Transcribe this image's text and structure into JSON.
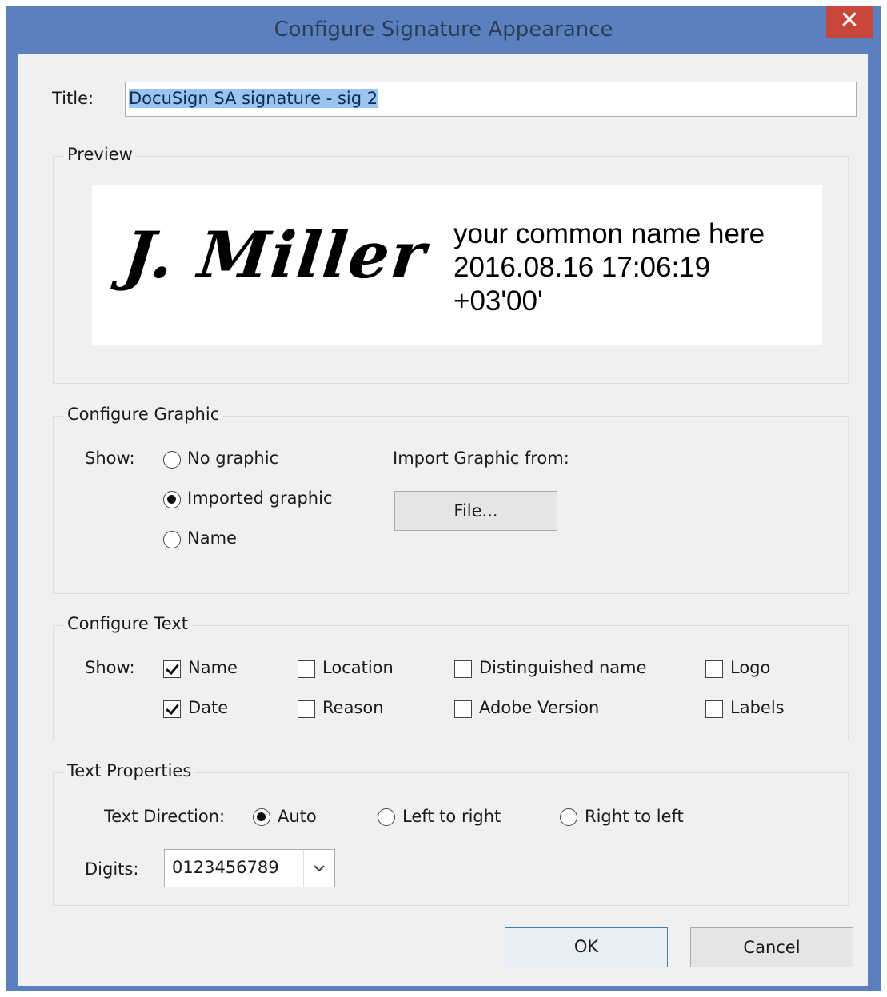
{
  "window": {
    "title": "Configure Signature Appearance",
    "close_glyph": "✕"
  },
  "title_field": {
    "label": "Title:",
    "value": "DocuSign SA signature - sig 2"
  },
  "preview": {
    "group_title": "Preview",
    "signature_graphic": "J. Miller",
    "text_lines": [
      "your common name here",
      "2016.08.16 17:06:19",
      "+03'00'"
    ]
  },
  "configure_graphic": {
    "group_title": "Configure Graphic",
    "show_label": "Show:",
    "options": [
      {
        "label": "No graphic",
        "selected": false
      },
      {
        "label": "Imported graphic",
        "selected": true
      },
      {
        "label": "Name",
        "selected": false
      }
    ],
    "import_label": "Import Graphic from:",
    "file_button": "File..."
  },
  "configure_text": {
    "group_title": "Configure Text",
    "show_label": "Show:",
    "checkboxes": [
      {
        "label": "Name",
        "checked": true
      },
      {
        "label": "Location",
        "checked": false
      },
      {
        "label": "Distinguished name",
        "checked": false
      },
      {
        "label": "Logo",
        "checked": false
      },
      {
        "label": "Date",
        "checked": true
      },
      {
        "label": "Reason",
        "checked": false
      },
      {
        "label": "Adobe Version",
        "checked": false
      },
      {
        "label": "Labels",
        "checked": false
      }
    ]
  },
  "text_properties": {
    "group_title": "Text Properties",
    "direction_label": "Text Direction:",
    "directions": [
      {
        "label": "Auto",
        "selected": true
      },
      {
        "label": "Left to right",
        "selected": false
      },
      {
        "label": "Right to left",
        "selected": false
      }
    ],
    "digits_label": "Digits:",
    "digits_value": "0123456789"
  },
  "buttons": {
    "ok": "OK",
    "cancel": "Cancel"
  },
  "colors": {
    "title_bar": "#5a80bf",
    "close_button": "#c9463d",
    "selection": "#99c5ee"
  }
}
